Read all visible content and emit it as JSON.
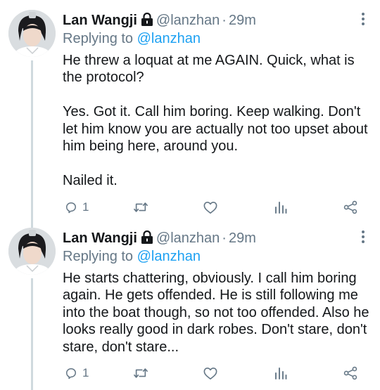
{
  "tweets": [
    {
      "name": "Lan Wangji",
      "handle": "@lanzhan",
      "separator": "·",
      "time": "29m",
      "replying_prefix": "Replying to",
      "replying_to": "@lanzhan",
      "paragraphs": [
        "He threw a loquat at me AGAIN. Quick, what is the protocol?",
        "Yes. Got it. Call him boring. Keep walking. Don't let him know you are actually not too upset about him being here, around you.",
        "Nailed it."
      ],
      "reply_count": "1",
      "icons": [
        "reply-icon",
        "retweet-icon",
        "like-icon",
        "analytics-icon",
        "share-icon"
      ]
    },
    {
      "name": "Lan Wangji",
      "handle": "@lanzhan",
      "separator": "·",
      "time": "29m",
      "replying_prefix": "Replying to",
      "replying_to": "@lanzhan",
      "paragraphs": [
        "He starts chattering, obviously. I call him boring again. He gets offended. He is still following me into the boat though, so not too offended. Also he looks really good in dark robes. Don't stare, don't stare, don't stare..."
      ],
      "reply_count": "1",
      "icons": [
        "reply-icon",
        "retweet-icon",
        "like-icon",
        "analytics-icon",
        "share-icon"
      ]
    }
  ],
  "colors": {
    "text": "#14171a",
    "secondary": "#657786",
    "link": "#1da1f2",
    "thread_line": "#cfd9de"
  }
}
